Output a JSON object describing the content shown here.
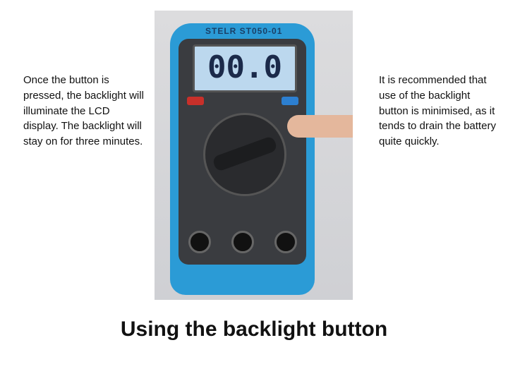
{
  "left_text": "Once the button is pressed,  the backlight will illuminate the LCD display. The backlight will stay on for three minutes.",
  "right_text": "It is recommended that use of the backlight button is minimised, as it tends to drain the battery quite quickly.",
  "title": "Using the backlight button",
  "photo": {
    "brand": "STELR   ST050-01",
    "display": "00.0"
  }
}
